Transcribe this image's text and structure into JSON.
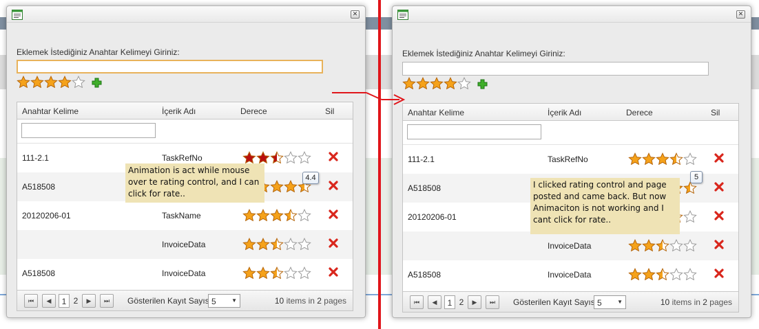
{
  "colors": {
    "annotation": "#e0151a",
    "note_bg": "#efe3b5",
    "focus_border": "#e8b25a",
    "star_hover": "#b80f0f",
    "star_gold": "#f5a21b",
    "delete_red": "#d9261c"
  },
  "panels": [
    {
      "id": "before",
      "prompt": "Eklemek İstediğiniz Anahtar Kelimeyi Giriniz:",
      "input_value": "",
      "input_focused": true,
      "input_rating": 4,
      "columns": [
        "Anahtar Kelime",
        "İçerik Adı",
        "Derece",
        "Sil"
      ],
      "filter_value": "",
      "rows": [
        {
          "keyword": "111-2.1",
          "content": "TaskRefNo",
          "rating": 2.5,
          "hover": true
        },
        {
          "keyword": "A518508",
          "content": "",
          "rating": 4.5
        },
        {
          "keyword": "20120206-01",
          "content": "TaskName",
          "rating": 3.5
        },
        {
          "keyword": "",
          "content": "InvoiceData",
          "rating": 2.5
        },
        {
          "keyword": "A518508",
          "content": "InvoiceData",
          "rating": 2.5
        }
      ],
      "pager": {
        "pages": [
          "1",
          "2"
        ],
        "current": "1",
        "page_size_label": "Gösterilen Kayıt Sayısı",
        "page_size": "5",
        "items_text": "items in",
        "items_count": "10",
        "pages_count": "2",
        "pages_word": "pages"
      },
      "tooltip": "4.4",
      "note": "Animation is act while mouse over te rating control, and I can click for rate.."
    },
    {
      "id": "after",
      "prompt": "Eklemek İstediğiniz Anahtar Kelimeyi Giriniz:",
      "input_value": "",
      "input_focused": false,
      "input_rating": 4,
      "columns": [
        "Anahtar Kelime",
        "İçerik Adı",
        "Derece",
        "Sil"
      ],
      "filter_value": "",
      "rows": [
        {
          "keyword": "111-2.1",
          "content": "TaskRefNo",
          "rating": 3.5
        },
        {
          "keyword": "A518508",
          "content": "",
          "rating": 4.5
        },
        {
          "keyword": "20120206-01",
          "content": "",
          "rating": 3.5
        },
        {
          "keyword": "",
          "content": "InvoiceData",
          "rating": 2.5
        },
        {
          "keyword": "A518508",
          "content": "InvoiceData",
          "rating": 2.5
        }
      ],
      "pager": {
        "pages": [
          "1",
          "2"
        ],
        "current": "1",
        "page_size_label": "Gösterilen Kayıt Sayısı",
        "page_size": "5",
        "items_text": "items in",
        "items_count": "10",
        "pages_count": "2",
        "pages_word": "pages"
      },
      "tooltip": "5",
      "note": "I clicked rating control and page posted and came back. But now Animaciton is not working and I cant click for rate.."
    }
  ]
}
